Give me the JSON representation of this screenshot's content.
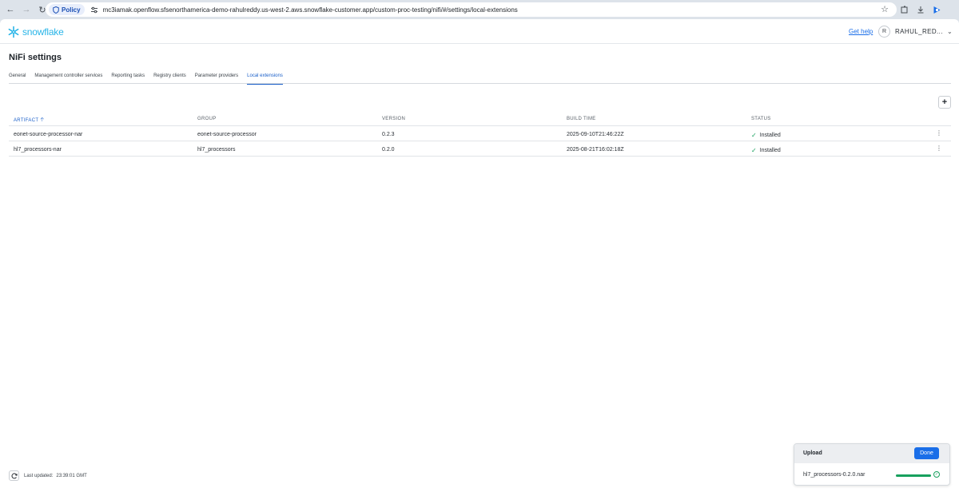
{
  "browser": {
    "policy_label": "Policy",
    "url": "mc3iamak.openflow.sfsenorthamerica-demo-rahulreddy.us-west-2.aws.snowflake-customer.app/custom-proc-testing/nifi/#/settings/local-extensions",
    "icons": [
      "back-arrow-icon",
      "forward-arrow-icon",
      "reload-icon",
      "shield-icon",
      "tune-icon",
      "star-icon",
      "extensions-icon",
      "download-icon",
      "profile-icon"
    ]
  },
  "header": {
    "logo_text": "snowflake",
    "get_help": "Get help",
    "avatar_initial": "R",
    "username": "RAHUL_RED..."
  },
  "page_title": "NiFi settings",
  "tabs": [
    {
      "label": "General"
    },
    {
      "label": "Management controller services"
    },
    {
      "label": "Reporting tasks"
    },
    {
      "label": "Registry clients"
    },
    {
      "label": "Parameter providers"
    },
    {
      "label": "Local extensions",
      "active": true
    }
  ],
  "table": {
    "columns": [
      "ARTIFACT",
      "GROUP",
      "VERSION",
      "BUILD TIME",
      "STATUS"
    ],
    "sorted_column": "ARTIFACT",
    "sort_direction": "ascending",
    "rows": [
      {
        "artifact": "eonet-source-processor-nar",
        "group": "eonet-source-processor",
        "version": "0.2.3",
        "build_time": "2025-09-10T21:46:22Z",
        "status": "Installed"
      },
      {
        "artifact": "hl7_processors-nar",
        "group": "hl7_processors",
        "version": "0.2.0",
        "build_time": "2025-08-21T16:02:18Z",
        "status": "Installed"
      }
    ]
  },
  "footer": {
    "last_updated_label": "Last updated:",
    "last_updated_time": "23:39:01 GMT"
  },
  "upload": {
    "title": "Upload",
    "done_label": "Done",
    "file_name": "hl7_processors-0.2.0.nar",
    "progress": 1.0
  },
  "colors": {
    "accent": "#1a6ee8",
    "brand": "#29b5e8",
    "success": "#17a05d"
  }
}
